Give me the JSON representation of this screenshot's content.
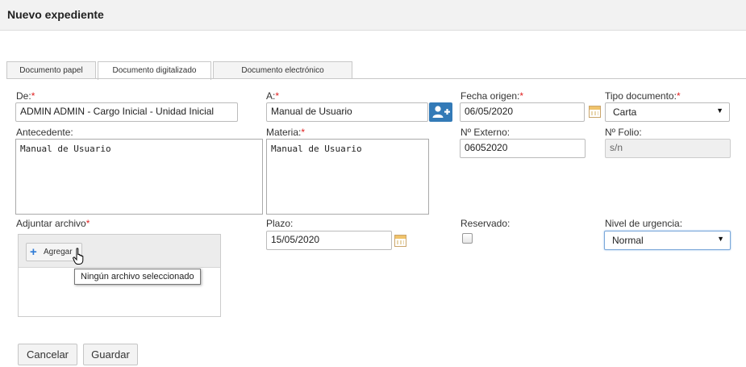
{
  "header": {
    "title": "Nuevo expediente"
  },
  "tabs": [
    {
      "label": "Documento papel"
    },
    {
      "label": "Documento digitalizado"
    },
    {
      "label": "Documento electrónico"
    }
  ],
  "form": {
    "de": {
      "label": "De:",
      "required_mark": "*",
      "value": "ADMIN ADMIN - Cargo Inicial - Unidad Inicial"
    },
    "a": {
      "label": "A:",
      "required_mark": "*",
      "value": "Manual de Usuario"
    },
    "fecha_origen": {
      "label": "Fecha origen:",
      "required_mark": "*",
      "value": "06/05/2020"
    },
    "tipo_documento": {
      "label": "Tipo documento:",
      "required_mark": "*",
      "value": "Carta"
    },
    "antecedente": {
      "label": "Antecedente:",
      "value": "Manual de Usuario"
    },
    "materia": {
      "label": "Materia:",
      "required_mark": "*",
      "value": "Manual de Usuario"
    },
    "n_externo": {
      "label": "Nº Externo:",
      "value": "06052020"
    },
    "n_folio": {
      "label": "Nº Folio:",
      "value": "s/n"
    },
    "adjuntar": {
      "label": "Adjuntar archivo",
      "required_mark": "*",
      "button": "Agregar",
      "tooltip": "Ningún archivo seleccionado"
    },
    "plazo": {
      "label": "Plazo:",
      "value": "15/05/2020"
    },
    "reservado": {
      "label": "Reservado:",
      "checked": false
    },
    "nivel_urgencia": {
      "label": "Nivel de urgencia:",
      "value": "Normal"
    }
  },
  "actions": {
    "cancel": "Cancelar",
    "save": "Guardar"
  },
  "colors": {
    "accent": "#337ab7",
    "required": "#e02020"
  }
}
